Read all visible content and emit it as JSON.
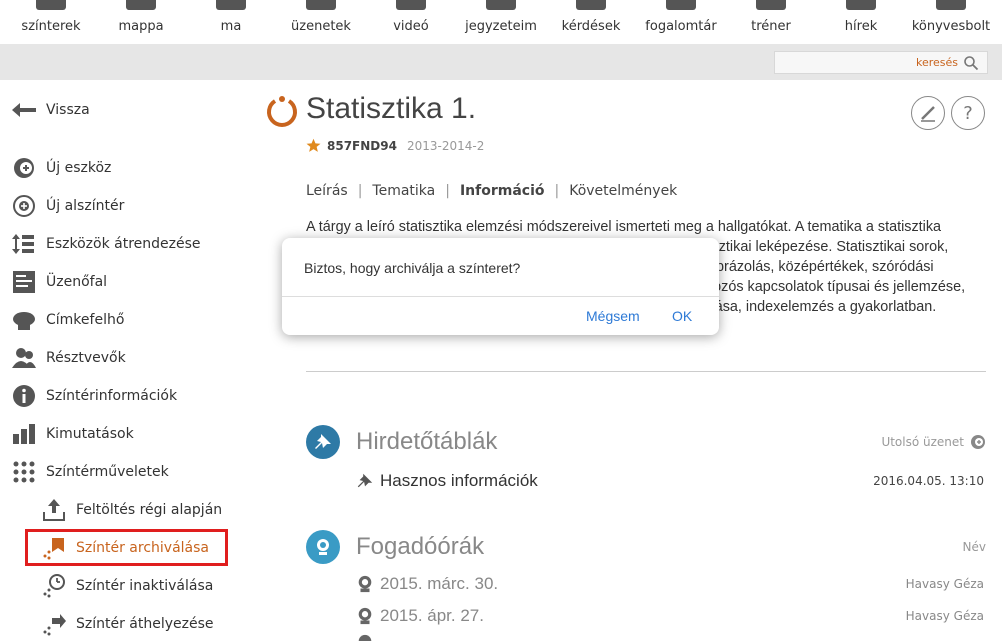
{
  "topnav": {
    "items": [
      {
        "label": "színterek",
        "icon": "courses-icon"
      },
      {
        "label": "mappa",
        "icon": "folder-icon"
      },
      {
        "label": "ma",
        "icon": "today-icon"
      },
      {
        "label": "üzenetek",
        "icon": "messages-icon"
      },
      {
        "label": "videó",
        "icon": "video-icon"
      },
      {
        "label": "jegyzeteim",
        "icon": "notes-icon"
      },
      {
        "label": "kérdések",
        "icon": "questions-icon"
      },
      {
        "label": "fogalomtár",
        "icon": "glossary-icon"
      },
      {
        "label": "tréner",
        "icon": "trainer-icon"
      },
      {
        "label": "hírek",
        "icon": "news-icon"
      },
      {
        "label": "könyvesbolt",
        "icon": "bookstore-icon"
      }
    ]
  },
  "search": {
    "placeholder": "keresés"
  },
  "sidebar": {
    "back_label": "Vissza",
    "items": [
      {
        "label": "Új eszköz",
        "icon": "add-tool-icon"
      },
      {
        "label": "Új alszíntér",
        "icon": "add-subcourse-icon"
      },
      {
        "label": "Eszközök átrendezése",
        "icon": "reorder-icon"
      },
      {
        "label": "Üzenőfal",
        "icon": "message-board-icon"
      },
      {
        "label": "Címkefelhő",
        "icon": "tag-cloud-icon"
      },
      {
        "label": "Résztvevők",
        "icon": "participants-icon"
      },
      {
        "label": "Színtérinformációk",
        "icon": "info-icon"
      },
      {
        "label": "Kimutatások",
        "icon": "stats-icon"
      },
      {
        "label": "Színtérműveletek",
        "icon": "operations-icon"
      }
    ],
    "subitems": [
      {
        "label": "Feltöltés régi alapján",
        "icon": "upload-icon"
      },
      {
        "label": "Színtér archiválása",
        "icon": "archive-icon"
      },
      {
        "label": "Színtér inaktiválása",
        "icon": "deactivate-icon"
      },
      {
        "label": "Színtér áthelyezése",
        "icon": "move-icon"
      }
    ]
  },
  "course": {
    "title": "Statisztika 1.",
    "code": "857FND94",
    "term": "2013-2014-2"
  },
  "tabs": [
    "Leírás",
    "Tematika",
    "Információ",
    "Követelmények"
  ],
  "active_tab": "Információ",
  "description": "A tárgy a leíró statisztika elemzési módszereivel ismerteti meg a hallgatókat.  A tematika a statisztika alapfogalmaival kezdődik (alapsokaság, ismérv). A valóság statisztikai leképezése. Statisztikai sorok, táblák. Egyszerű elemzési eszközök (Viszonyszámok, grafikus ábrázolás, középértékek, szóródási mutatók, alakmutatók, heterogén sokaságok vizsgálata). Kétváltozós kapcsolatok típusai és jellemzése, kétváltozós korreláció és regresszió. Indexszámítás és alkalmazása, indexelemzés a gyakorlatban. Idősorok elemzése.",
  "sections": {
    "board": {
      "title": "Hirdetőtáblák",
      "right_label": "Utolsó üzenet",
      "rows": [
        {
          "text": "Hasznos információk",
          "value": "2016.04.05. 13:10"
        }
      ]
    },
    "office_hours": {
      "title": "Fogadóórák",
      "right_label": "Név",
      "rows": [
        {
          "text": "2015. márc. 30.",
          "value": "Havasy Géza"
        },
        {
          "text": "2015. ápr. 27.",
          "value": "Havasy Géza"
        }
      ]
    }
  },
  "dialog": {
    "message": "Biztos, hogy archiválja a színteret?",
    "cancel_label": "Mégsem",
    "ok_label": "OK"
  },
  "colors": {
    "accent": "#c8641e",
    "section_blue": "#2e7aa6",
    "dialog_button": "#2e7ad6",
    "highlight_box": "#e01e1e"
  }
}
